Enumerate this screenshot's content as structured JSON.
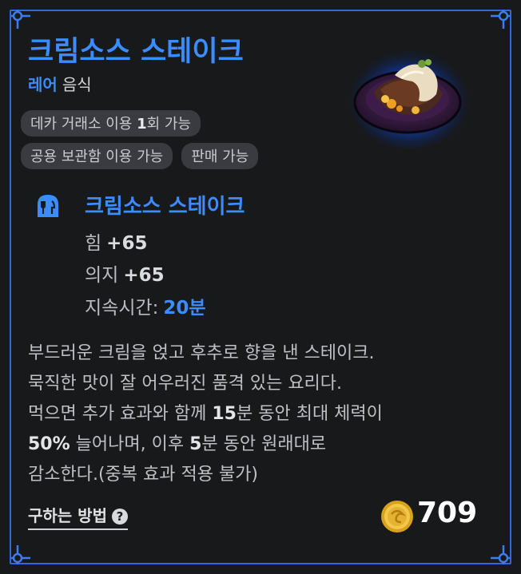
{
  "item": {
    "name": "크림소스 스테이크",
    "grade": "레어",
    "category": "음식"
  },
  "tags": [
    {
      "pre": "데카 거래소 이용 ",
      "bold": "1",
      "post": "회 가능"
    },
    {
      "pre": "공용 보관함 이용 가능",
      "bold": "",
      "post": ""
    },
    {
      "pre": "판매 가능",
      "bold": "",
      "post": ""
    }
  ],
  "effect": {
    "icon": "food-icon",
    "title": "크림소스 스테이크",
    "stats": [
      {
        "label": "힘",
        "value": "+65"
      },
      {
        "label": "의지",
        "value": "+65"
      }
    ],
    "duration_label": "지속시간:",
    "duration_value": "20분"
  },
  "description": {
    "line1": "부드러운 크림을 얹고 후추로 향을 낸 스테이크.",
    "line2": "묵직한 맛이 잘 어우러진 품격 있는 요리다.",
    "line3_a": "먹으면 추가 효과와 함께 ",
    "line3_b": "15",
    "line3_c": "분 동안 최대 체력이",
    "line4_a": "50%",
    "line4_b": " 늘어나며, 이후 ",
    "line4_c": "5",
    "line4_d": "분 동안 원래대로",
    "line5": "감소한다.(중복 효과 적용 불가)"
  },
  "footer": {
    "howto_label": "구하는 방법",
    "help_icon": "question-icon",
    "price": "709",
    "currency_icon": "gold-coin-icon"
  },
  "colors": {
    "accent": "#3b8cff",
    "frame": "#2d6ae0",
    "panel": "#18191b"
  }
}
